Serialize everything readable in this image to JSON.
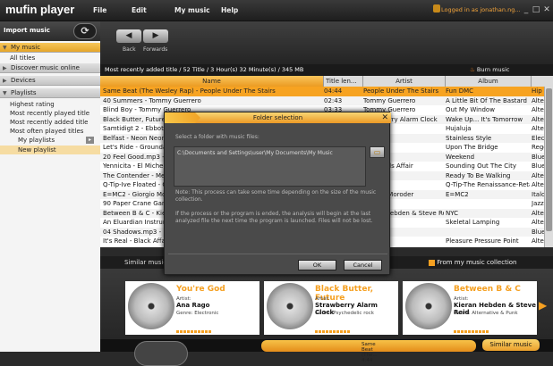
{
  "app": {
    "name": "mufin player",
    "menu": [
      "File",
      "Edit",
      "My music",
      "Help"
    ],
    "login": "Logged in as jonathan.ng..."
  },
  "sidebar": {
    "import_label": "Import music",
    "sections": [
      {
        "label": "My music"
      },
      {
        "label": "Discover music online"
      },
      {
        "label": "Devices"
      },
      {
        "label": "Playlists"
      }
    ],
    "my_music_items": [
      "All titles"
    ],
    "playlist_items": [
      "Highest rating",
      "Most recently played title",
      "Most recently added title",
      "Most often played titles",
      "My playlists",
      "New playlist"
    ]
  },
  "toolbar": {
    "back": "Back",
    "forwards": "Forwards"
  },
  "infobar": {
    "text": "Most recently added title / 52 Title / 3 Hour(s) 32 Minute(s) / 345 MB",
    "burn": "Burn music"
  },
  "table": {
    "headers": [
      "Name",
      "Title len...",
      "Artist",
      "Album",
      ""
    ],
    "rows": [
      [
        "Same Beat (The Wesley Rap) - People Under The Stairs",
        "04:44",
        "People Under The Stairs",
        "Fun DMC",
        "Hip"
      ],
      [
        "40 Summers - Tommy Guerrero",
        "02:43",
        "Tommy Guerrero",
        "A Little Bit Of The Bastard",
        "Alte"
      ],
      [
        "Blind Boy - Tommy Guerrero",
        "03:33",
        "Tommy Guerrero",
        "Out My Window",
        "Alte"
      ],
      [
        "Black Butter, Future",
        "",
        "Strawberry Alarm Clock",
        "Wake Up... It's Tomorrow",
        "Alte"
      ],
      [
        "Samtidigt 2 - Ebbot Lundberg",
        "",
        "",
        "Hujaluja",
        "Alte"
      ],
      [
        "Belfast - Neon Neon",
        "",
        "",
        "Stainless Style",
        "Elec"
      ],
      [
        "Let's Ride - Groundation",
        "",
        "",
        "Upon The Bridge",
        "Regg"
      ],
      [
        "20 Feel Good.mp3 - DJ",
        "",
        "",
        "Weekend",
        "Blue"
      ],
      [
        "Yennicita - El Michels Affair",
        "",
        "El Michels Affair",
        "Sounding Out The City",
        "Blue"
      ],
      [
        "The Contender - Mercury Program",
        "",
        "",
        "Ready To Be Walking",
        "Alte"
      ],
      [
        "Q-Tip-Ive Floated - Q-Tip",
        "",
        "",
        "Q-Tip-The Renaissance-Retail",
        "Alte"
      ],
      [
        "E=MC2 - Giorgio Moroder",
        "",
        "Giorgio Moroder",
        "E=MC2",
        "Italo"
      ],
      [
        "90 Paper Crane Gang",
        "",
        "",
        "",
        "Jazz"
      ],
      [
        "Between B & C - Kieran Hebden",
        "",
        "Kieran Hebden & Steve Reid",
        "NYC",
        "Alte"
      ],
      [
        "An Eluardian Instrument",
        "",
        "",
        "Skeletal Lamping",
        "Alte"
      ],
      [
        "04 Shadows.mp3 - DJ",
        "",
        "",
        "",
        "Blue"
      ],
      [
        "It's Real - Black Affair",
        "",
        "",
        "Pleasure Pressure Point",
        "Alte"
      ]
    ]
  },
  "dialog": {
    "title": "Folder selection",
    "prompt": "Select a folder with music files:",
    "path": "C:\\Documents and Settings\\user\\My Documents\\My Music",
    "note1": "Note: This process can take some time depending on the size of the music collection.",
    "note2": "If the process or the program is ended, the analysis will begin at the last analyzed file the next time the program is launched. Files will not be lost.",
    "ok": "OK",
    "cancel": "Cancel"
  },
  "similar": {
    "tab": "Similar music",
    "source": "From my music collection",
    "cards": [
      {
        "title": "You're God",
        "artist_label": "Artist:",
        "artist": "Ana Rago",
        "genre": "Genre: Electronic"
      },
      {
        "title": "Black Butter, Future",
        "artist_label": "Artist:",
        "artist": "Strawberry Alarm Clock",
        "genre": "Genre: Psychedelic rock"
      },
      {
        "title": "Between B & C",
        "artist_label": "Artist:",
        "artist": "Kieran Hebden & Steve Reid",
        "genre": "Genre: Alternative & Punk"
      }
    ]
  },
  "player": {
    "now": "Same Beat (The...",
    "sub": "4:44",
    "similar_btn": "Similar music"
  },
  "colors": {
    "accent": "#f5a021",
    "selected_row": "#f7a321"
  }
}
